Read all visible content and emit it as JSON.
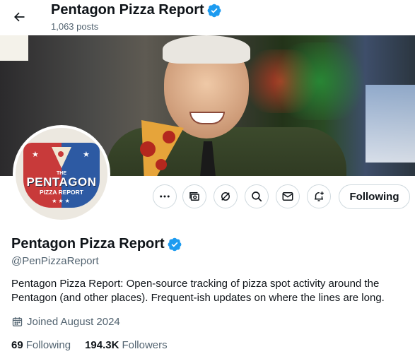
{
  "header": {
    "back_icon": "arrow-left-icon",
    "title": "Pentagon Pizza Report",
    "post_count": "1,063 posts"
  },
  "colors": {
    "verified_blue": "#1d9bf0",
    "text_primary": "#0f1419",
    "text_secondary": "#536471",
    "border": "#cfd9de"
  },
  "avatar": {
    "logo_top": "THE",
    "logo_name": "PENTAGON",
    "logo_sub": "PIZZA REPORT",
    "logo_stars": "★★★"
  },
  "actions": {
    "more_icon": "more-dots-icon",
    "media_icon": "media-stack-icon",
    "grok_icon": "grok-slash-icon",
    "search_icon": "search-icon",
    "message_icon": "envelope-icon",
    "notify_icon": "bell-plus-icon",
    "following_label": "Following"
  },
  "profile": {
    "name": "Pentagon Pizza Report",
    "handle": "@PenPizzaReport",
    "bio": "Pentagon Pizza Report: Open-source tracking of pizza spot activity around the Pentagon (and other places). Frequent-ish updates on where the lines are long.",
    "joined": "Joined August 2024",
    "following_count": "69",
    "following_label": "Following",
    "followers_count": "194.3K",
    "followers_label": "Followers"
  }
}
